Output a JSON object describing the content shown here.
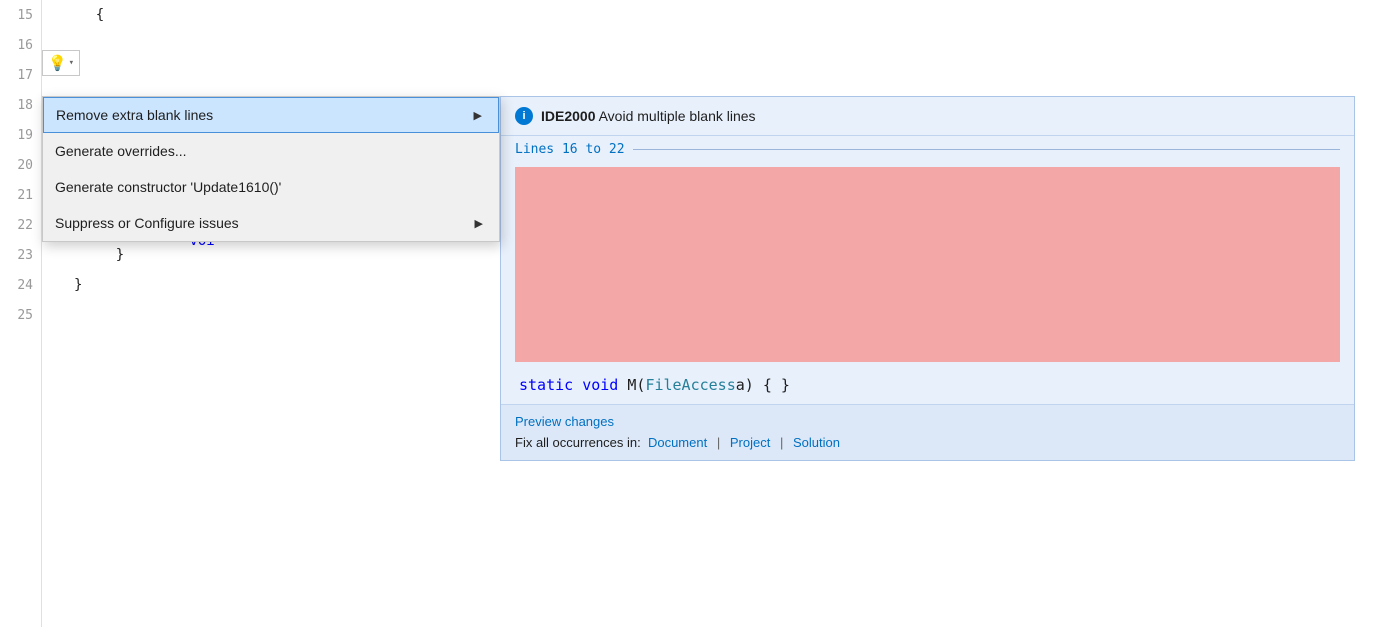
{
  "lines": [
    {
      "number": "15",
      "content": "    {",
      "type": "brace"
    },
    {
      "number": "16",
      "content": "",
      "type": "blank"
    },
    {
      "number": "17",
      "content": "",
      "type": "blank"
    },
    {
      "number": "18",
      "content": "",
      "type": "blank"
    },
    {
      "number": "19",
      "content": "",
      "type": "blank"
    },
    {
      "number": "20",
      "content": "",
      "type": "blank"
    },
    {
      "number": "21",
      "content": "",
      "type": "blank"
    },
    {
      "number": "22",
      "content": "        static voi",
      "type": "code"
    },
    {
      "number": "23",
      "content": "    }",
      "type": "brace"
    },
    {
      "number": "24",
      "content": "}",
      "type": "brace"
    },
    {
      "number": "25",
      "content": "",
      "type": "blank"
    }
  ],
  "lightbulb": {
    "icon": "💡",
    "arrow": "▾"
  },
  "menu": {
    "items": [
      {
        "id": "remove-blank-lines",
        "label": "Remove extra blank lines",
        "hasArrow": true,
        "active": true
      },
      {
        "id": "generate-overrides",
        "label": "Generate overrides...",
        "hasArrow": false,
        "active": false
      },
      {
        "id": "generate-constructor",
        "label": "Generate constructor 'Update1610()'",
        "hasArrow": false,
        "active": false
      },
      {
        "id": "suppress-configure",
        "label": "Suppress or Configure issues",
        "hasArrow": true,
        "active": false
      }
    ]
  },
  "preview": {
    "info_icon": "i",
    "title_code": "IDE2000",
    "title_text": " Avoid multiple blank lines",
    "lines_label": "Lines 16 to 22",
    "code_line": "static void M(FileAccess a) { }",
    "footer": {
      "preview_link": "Preview changes",
      "fix_prefix": "Fix all occurrences in:",
      "fix_document": "Document",
      "fix_project": "Project",
      "fix_solution": "Solution",
      "separator": "|"
    }
  }
}
